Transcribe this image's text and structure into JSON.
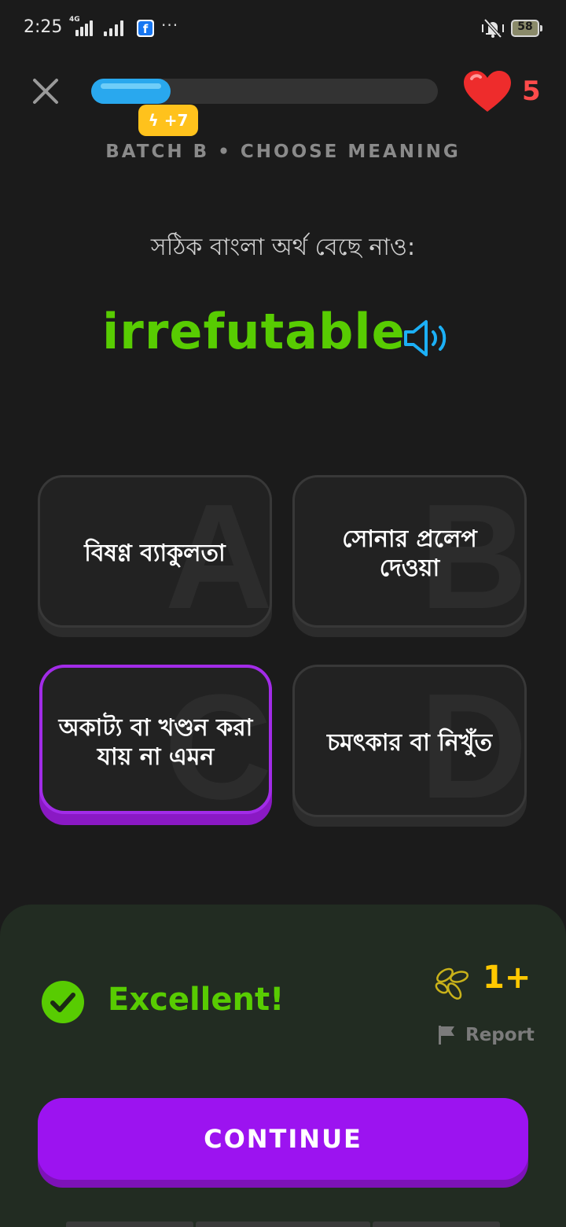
{
  "status_bar": {
    "time": "2:25",
    "network_label": "4G",
    "battery_level": "58",
    "app_icon": "facebook-icon",
    "more": "···"
  },
  "lesson": {
    "progress_fraction": 0.23,
    "xp_badge": "+7",
    "hearts": "5",
    "batch_label": "BATCH B • CHOOSE MEANING"
  },
  "question": {
    "instruction": "সঠিক বাংলা অর্থ বেছে নাও:",
    "word": "irrefutable",
    "audio_icon": "speaker-icon"
  },
  "options": [
    {
      "letter": "A",
      "text": "বিষণ্ণ ব্যাকুলতা",
      "selected": false
    },
    {
      "letter": "B",
      "text": "সোনার প্রলেপ দেওয়া",
      "selected": false
    },
    {
      "letter": "C",
      "text": "অকাট্য বা খণ্ডন করা যায় না এমন",
      "selected": true
    },
    {
      "letter": "D",
      "text": "চমৎকার বা নিখুঁত",
      "selected": false
    }
  ],
  "result": {
    "title": "Excellent!",
    "reward": "1+",
    "report_label": "Report",
    "continue_label": "CONTINUE"
  },
  "colors": {
    "background": "#1b1b1b",
    "correct_green": "#58cc02",
    "accent_purple": "#9c13f0",
    "progress_blue": "#29a8ee",
    "heart_red": "#ff4b4b",
    "xp_yellow": "#ffc21c"
  }
}
